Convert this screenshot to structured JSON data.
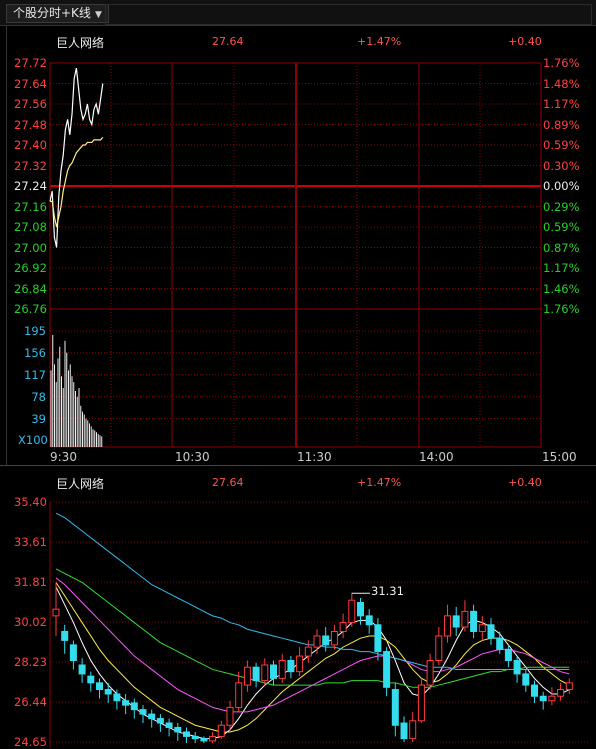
{
  "toolbar": {
    "tab_label": "个股分时+K线",
    "chevron": "▼"
  },
  "intraday": {
    "stock_name": "巨人网络",
    "last_price": "27.64",
    "change_pct": "+1.47%",
    "change_amt": "+0.40",
    "price_ticks": [
      "27.72",
      "27.64",
      "27.56",
      "27.48",
      "27.40",
      "27.32",
      "27.24",
      "27.16",
      "27.08",
      "27.00",
      "26.92",
      "26.84",
      "26.76"
    ],
    "pct_ticks": [
      "1.76%",
      "1.48%",
      "1.17%",
      "0.89%",
      "0.59%",
      "0.30%",
      "0.00%",
      "0.29%",
      "0.59%",
      "0.87%",
      "1.17%",
      "1.46%",
      "1.76%"
    ],
    "volume_ticks": [
      "195",
      "156",
      "117",
      "78",
      "39"
    ],
    "volume_unit": "X100",
    "time_ticks": [
      "9:30",
      "10:30",
      "11:30",
      "14:00",
      "15:00"
    ],
    "colors": {
      "up": "#ff4040",
      "down": "#27d027",
      "flat": "#eeeeee",
      "volume_axis": "#33bbee",
      "grid": "#8b0000"
    }
  },
  "kline": {
    "stock_name": "巨人网络",
    "last_price": "27.64",
    "change_pct": "+1.47%",
    "change_amt": "+0.40",
    "price_ticks": [
      "35.40",
      "33.61",
      "31.81",
      "30.02",
      "28.23",
      "26.44",
      "24.65"
    ],
    "peak_label": "31.31"
  },
  "chart_data": [
    {
      "type": "line",
      "name": "intraday",
      "x_range": [
        "9:30",
        "15:00"
      ],
      "ylim": [
        26.76,
        27.72
      ],
      "reference_price": 27.24,
      "series": [
        {
          "values": [
            27.18,
            27.22,
            27.04,
            27.0,
            27.2,
            27.3,
            27.36,
            27.46,
            27.5,
            27.44,
            27.52,
            27.66,
            27.7,
            27.62,
            27.54,
            27.5,
            27.52,
            27.56,
            27.5,
            27.48,
            27.54,
            27.56,
            27.52,
            27.58,
            27.64
          ]
        },
        {
          "values": [
            27.18,
            27.18,
            27.12,
            27.08,
            27.12,
            27.16,
            27.22,
            27.26,
            27.3,
            27.32,
            27.33,
            27.35,
            27.37,
            27.38,
            27.39,
            27.4,
            27.4,
            27.41,
            27.41,
            27.41,
            27.42,
            27.42,
            27.42,
            27.42,
            27.43
          ]
        }
      ],
      "volume": [
        130,
        190,
        140,
        110,
        150,
        170,
        120,
        100,
        180,
        160,
        130,
        140,
        120,
        110,
        95,
        85,
        100,
        70,
        60,
        55,
        48,
        45,
        40,
        35,
        30,
        28,
        25,
        22,
        20,
        18
      ]
    },
    {
      "type": "candlestick",
      "name": "kline",
      "ylim": [
        24.65,
        35.4
      ],
      "candles": [
        [
          30.3,
          30.6,
          29.4,
          31.8
        ],
        [
          29.6,
          29.2,
          28.6,
          29.9
        ],
        [
          29.0,
          28.3,
          27.9,
          29.2
        ],
        [
          28.1,
          27.7,
          27.3,
          28.4
        ],
        [
          27.6,
          27.3,
          26.9,
          27.8
        ],
        [
          27.3,
          27.0,
          26.6,
          27.5
        ],
        [
          27.0,
          26.8,
          26.4,
          27.3
        ],
        [
          26.8,
          26.5,
          26.1,
          27.0
        ],
        [
          26.5,
          26.3,
          25.9,
          26.8
        ],
        [
          26.4,
          26.1,
          25.7,
          26.6
        ],
        [
          26.1,
          25.9,
          25.5,
          26.3
        ],
        [
          25.9,
          25.7,
          25.3,
          26.1
        ],
        [
          25.7,
          25.5,
          25.1,
          25.9
        ],
        [
          25.5,
          25.3,
          24.9,
          25.7
        ],
        [
          25.3,
          25.1,
          24.7,
          25.5
        ],
        [
          25.1,
          24.9,
          24.6,
          25.3
        ],
        [
          24.9,
          24.8,
          24.6,
          25.1
        ],
        [
          24.8,
          24.7,
          24.6,
          24.9
        ],
        [
          24.7,
          24.9,
          24.6,
          25.1
        ],
        [
          24.9,
          25.4,
          24.8,
          25.6
        ],
        [
          25.4,
          26.2,
          25.2,
          26.5
        ],
        [
          26.2,
          27.3,
          26.0,
          27.8
        ],
        [
          27.2,
          28.0,
          26.9,
          28.3
        ],
        [
          28.0,
          27.4,
          27.1,
          28.2
        ],
        [
          27.4,
          28.1,
          27.2,
          28.4
        ],
        [
          28.1,
          27.5,
          27.2,
          28.3
        ],
        [
          27.5,
          28.3,
          27.3,
          28.6
        ],
        [
          28.3,
          27.8,
          27.5,
          28.5
        ],
        [
          27.8,
          28.5,
          27.6,
          28.9
        ],
        [
          28.5,
          28.9,
          28.2,
          29.2
        ],
        [
          28.9,
          29.4,
          28.6,
          29.7
        ],
        [
          29.4,
          29.0,
          28.7,
          29.8
        ],
        [
          29.0,
          29.6,
          28.8,
          29.9
        ],
        [
          29.6,
          30.0,
          29.3,
          30.4
        ],
        [
          30.0,
          31.0,
          29.8,
          31.31
        ],
        [
          30.9,
          30.3,
          29.9,
          31.1
        ],
        [
          30.3,
          29.9,
          29.5,
          30.6
        ],
        [
          29.9,
          28.7,
          28.3,
          30.2
        ],
        [
          28.7,
          27.1,
          26.7,
          28.9
        ],
        [
          27.0,
          25.4,
          24.9,
          27.3
        ],
        [
          25.5,
          24.8,
          24.65,
          25.8
        ],
        [
          24.8,
          25.6,
          24.65,
          26.0
        ],
        [
          25.6,
          27.2,
          25.5,
          27.5
        ],
        [
          27.2,
          28.3,
          27.0,
          28.6
        ],
        [
          28.3,
          29.4,
          28.1,
          29.8
        ],
        [
          29.4,
          30.3,
          29.1,
          30.8
        ],
        [
          30.3,
          29.8,
          29.4,
          30.7
        ],
        [
          29.8,
          30.5,
          29.6,
          31.0
        ],
        [
          30.5,
          29.6,
          29.3,
          30.8
        ],
        [
          29.6,
          29.9,
          29.2,
          30.3
        ],
        [
          29.9,
          29.3,
          29.0,
          30.2
        ],
        [
          29.3,
          28.8,
          28.6,
          29.6
        ],
        [
          28.8,
          28.3,
          28.0,
          29.0
        ],
        [
          28.3,
          27.7,
          27.3,
          28.5
        ],
        [
          27.7,
          27.2,
          26.9,
          27.9
        ],
        [
          27.2,
          26.7,
          26.4,
          27.4
        ],
        [
          26.7,
          26.5,
          26.1,
          26.9
        ],
        [
          26.5,
          26.7,
          26.3,
          27.1
        ],
        [
          26.7,
          27.0,
          26.5,
          27.3
        ],
        [
          27.0,
          27.3,
          26.8,
          27.5
        ]
      ],
      "moving_averages": [
        {
          "color": "#ffffff",
          "values": [
            31.6,
            30.8,
            30.0,
            29.1,
            28.3,
            27.7,
            27.2,
            26.8,
            26.5,
            26.2,
            25.9,
            25.7,
            25.5,
            25.3,
            25.1,
            25.0,
            24.9,
            24.8,
            24.8,
            24.9,
            25.2,
            25.7,
            26.3,
            26.8,
            27.2,
            27.5,
            27.7,
            27.9,
            28.2,
            28.5,
            28.8,
            29.1,
            29.3,
            29.6,
            30.0,
            30.1,
            30.1,
            29.8,
            29.2,
            28.3,
            27.3,
            26.8,
            26.7,
            27.1,
            27.7,
            28.4,
            29.2,
            29.9,
            30.1,
            30.0,
            29.8,
            29.5,
            29.0,
            28.5,
            28.0,
            27.5,
            27.1,
            26.8,
            26.8,
            27.0
          ]
        },
        {
          "color": "#ffee44",
          "values": [
            31.8,
            31.2,
            30.6,
            30.0,
            29.4,
            28.8,
            28.3,
            27.9,
            27.5,
            27.1,
            26.8,
            26.5,
            26.2,
            26.0,
            25.8,
            25.6,
            25.4,
            25.3,
            25.2,
            25.1,
            25.1,
            25.2,
            25.4,
            25.7,
            26.1,
            26.5,
            26.9,
            27.2,
            27.5,
            27.8,
            28.1,
            28.4,
            28.6,
            28.9,
            29.1,
            29.3,
            29.4,
            29.4,
            29.2,
            28.9,
            28.4,
            27.9,
            27.5,
            27.3,
            27.4,
            27.7,
            28.1,
            28.6,
            29.0,
            29.2,
            29.3,
            29.3,
            29.2,
            29.0,
            28.7,
            28.4,
            28.0,
            27.7,
            27.4,
            27.2
          ]
        },
        {
          "color": "#ff55ff",
          "values": [
            32.0,
            31.7,
            31.3,
            30.9,
            30.5,
            30.1,
            29.7,
            29.3,
            28.9,
            28.5,
            28.2,
            27.9,
            27.6,
            27.3,
            27.0,
            26.8,
            26.6,
            26.4,
            26.2,
            26.1,
            26.0,
            26.0,
            26.0,
            26.1,
            26.2,
            26.3,
            26.5,
            26.7,
            26.9,
            27.1,
            27.3,
            27.5,
            27.7,
            27.9,
            28.1,
            28.3,
            28.4,
            28.5,
            28.5,
            28.4,
            28.3,
            28.1,
            27.9,
            27.8,
            27.8,
            27.9,
            28.0,
            28.2,
            28.4,
            28.6,
            28.7,
            28.8,
            28.8,
            28.7,
            28.6,
            28.4,
            28.2,
            28.0,
            27.8,
            27.7
          ]
        },
        {
          "color": "#33dd33",
          "values": [
            32.4,
            32.2,
            32.0,
            31.8,
            31.5,
            31.2,
            30.9,
            30.6,
            30.3,
            30.0,
            29.7,
            29.4,
            29.1,
            28.9,
            28.7,
            28.5,
            28.3,
            28.1,
            27.9,
            27.8,
            27.7,
            27.6,
            27.5,
            27.4,
            27.3,
            27.2,
            27.2,
            27.2,
            27.2,
            27.2,
            27.2,
            27.3,
            27.3,
            27.3,
            27.4,
            27.4,
            27.4,
            27.4,
            27.3,
            27.3,
            27.2,
            27.1,
            27.1,
            27.1,
            27.2,
            27.3,
            27.4,
            27.5,
            27.6,
            27.7,
            27.8,
            27.8,
            27.9,
            27.9,
            28.0,
            28.0,
            28.0,
            28.0,
            28.0,
            28.0
          ]
        },
        {
          "color": "#33bbee",
          "values": [
            34.9,
            34.7,
            34.4,
            34.1,
            33.8,
            33.5,
            33.2,
            32.9,
            32.6,
            32.3,
            32.0,
            31.7,
            31.5,
            31.3,
            31.1,
            30.9,
            30.7,
            30.5,
            30.3,
            30.2,
            30.0,
            29.9,
            29.7,
            29.6,
            29.5,
            29.4,
            29.3,
            29.2,
            29.1,
            29.0,
            29.0,
            28.9,
            28.9,
            28.8,
            28.8,
            28.7,
            28.7,
            28.6,
            28.5,
            28.4,
            28.3,
            28.2,
            28.1,
            28.0,
            28.0,
            28.0,
            27.9,
            27.9,
            27.9,
            27.9,
            27.9,
            27.9,
            27.9,
            27.9,
            27.9,
            27.9,
            27.9,
            27.9,
            27.9,
            27.9
          ]
        }
      ]
    }
  ]
}
